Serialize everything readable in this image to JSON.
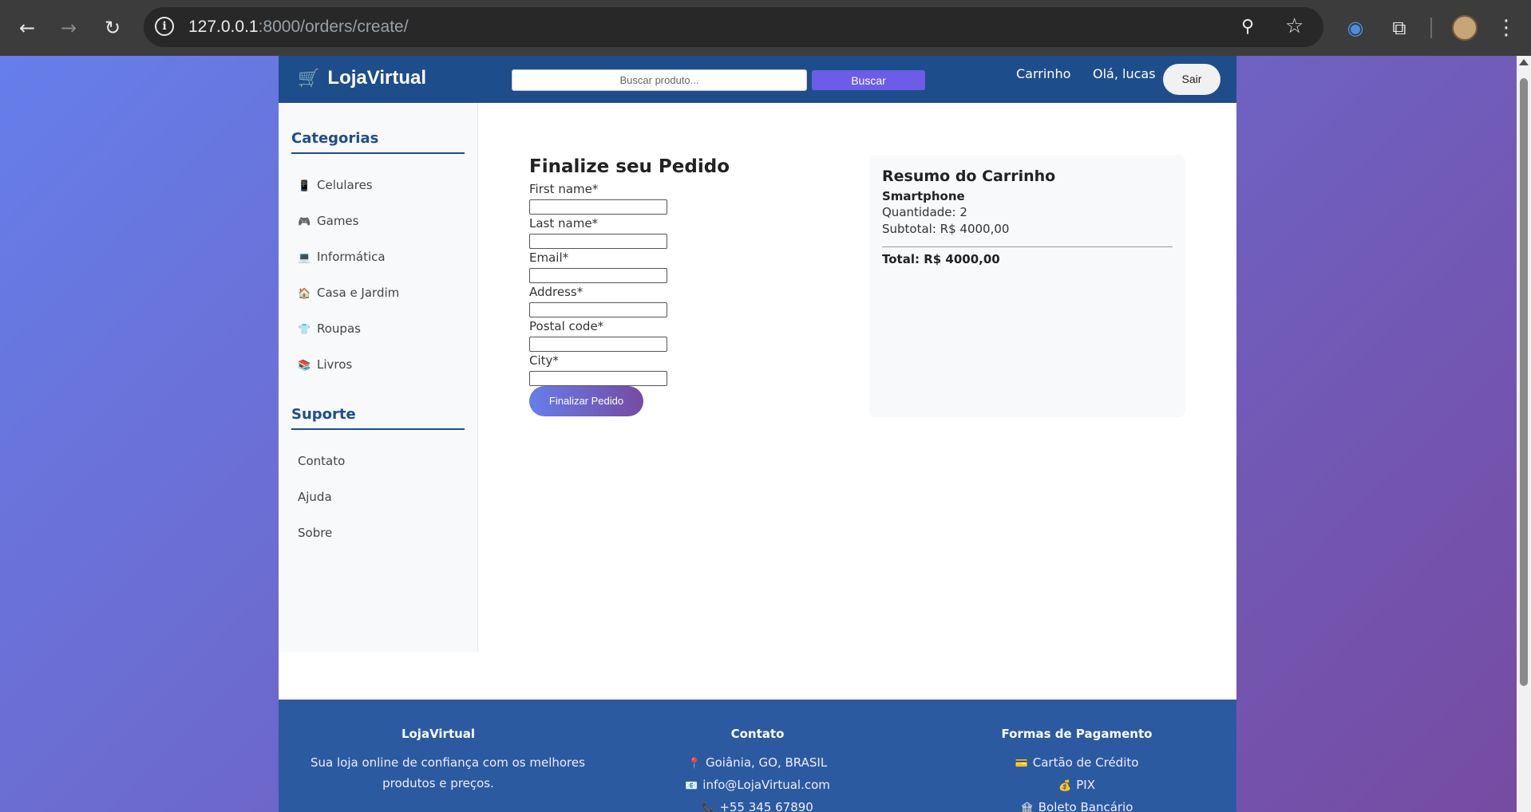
{
  "browser": {
    "url_host": "127.0.0.1",
    "url_path": ":8000/orders/create/"
  },
  "header": {
    "logo": "LojaVirtual",
    "search_placeholder": "Buscar produto...",
    "search_button": "Buscar",
    "cart_link": "Carrinho",
    "greeting": "Olá, lucas",
    "logout_button": "Sair"
  },
  "sidebar": {
    "categories_title": "Categorias",
    "categories": [
      {
        "icon": "📱",
        "label": "Celulares"
      },
      {
        "icon": "🎮",
        "label": "Games"
      },
      {
        "icon": "💻",
        "label": "Informática"
      },
      {
        "icon": "🏠",
        "label": "Casa e Jardim"
      },
      {
        "icon": "👕",
        "label": "Roupas"
      },
      {
        "icon": "📚",
        "label": "Livros"
      }
    ],
    "support_title": "Suporte",
    "support": [
      "Contato",
      "Ajuda",
      "Sobre"
    ]
  },
  "form": {
    "title": "Finalize seu Pedido",
    "fields": [
      {
        "label": "First name*",
        "value": ""
      },
      {
        "label": "Last name*",
        "value": ""
      },
      {
        "label": "Email*",
        "value": ""
      },
      {
        "label": "Address*",
        "value": ""
      },
      {
        "label": "Postal code*",
        "value": ""
      },
      {
        "label": "City*",
        "value": ""
      }
    ],
    "submit": "Finalizar Pedido"
  },
  "summary": {
    "title": "Resumo do Carrinho",
    "product": "Smartphone",
    "quantity": "Quantidade: 2",
    "subtotal": "Subtotal: R$ 4000,00",
    "total": "Total: R$ 4000,00"
  },
  "footer": {
    "about_title": "LojaVirtual",
    "about_line1": "Sua loja online de confiança com os melhores",
    "about_line2": "produtos e preços.",
    "contact_title": "Contato",
    "contact": [
      {
        "icon": "📍",
        "text": "Goiânia, GO, BRASIL"
      },
      {
        "icon": "📧",
        "text": "info@LojaVirtual.com"
      },
      {
        "icon": "📞",
        "text": "+55 345 67890"
      }
    ],
    "payment_title": "Formas de Pagamento",
    "payments": [
      {
        "icon": "💳",
        "text": "Cartão de Crédito"
      },
      {
        "icon": "💰",
        "text": "PIX"
      },
      {
        "icon": "🏦",
        "text": "Boleto Bancário"
      }
    ]
  }
}
